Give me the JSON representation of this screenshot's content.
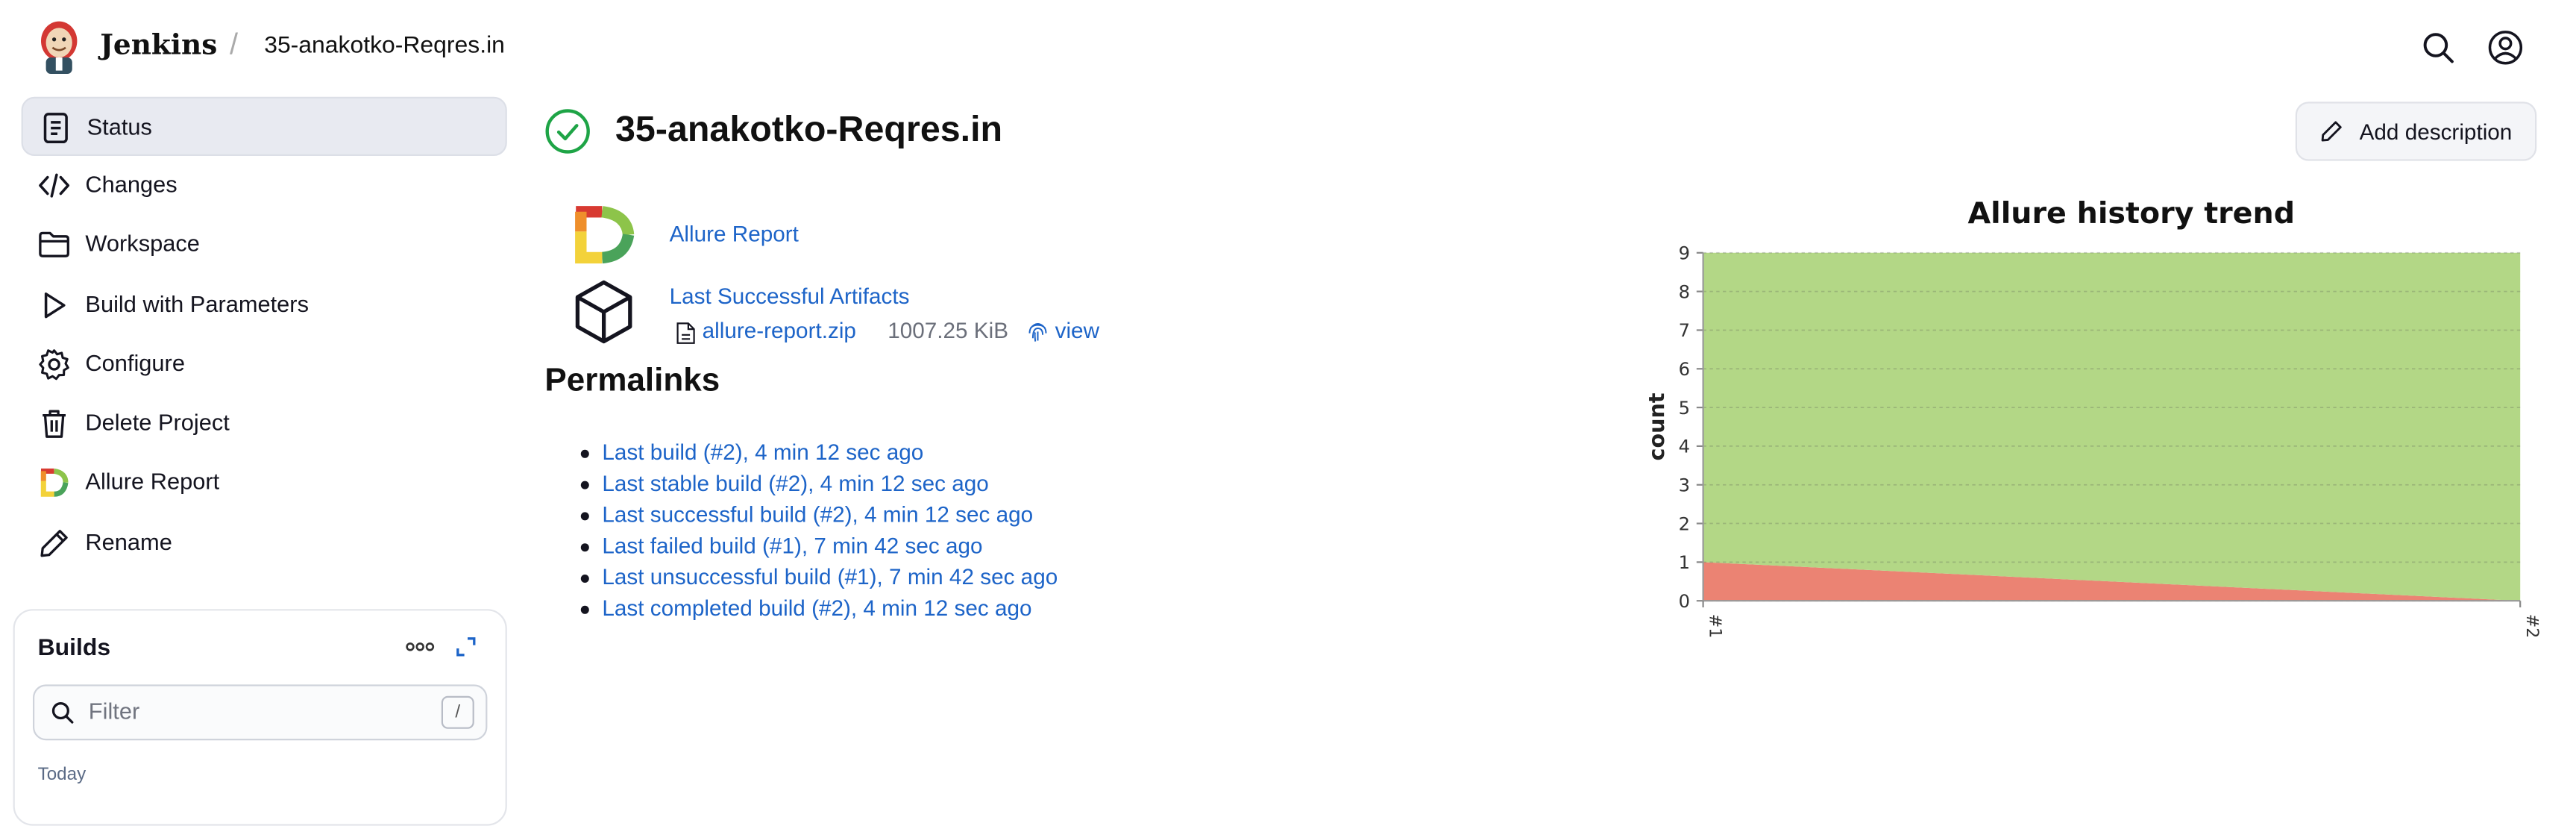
{
  "header": {
    "brand": "Jenkins",
    "breadcrumb": "35-anakotko-Reqres.in"
  },
  "sidebar": {
    "items": [
      {
        "label": "Status",
        "icon": "status-document-icon",
        "active": true
      },
      {
        "label": "Changes",
        "icon": "code-icon"
      },
      {
        "label": "Workspace",
        "icon": "folder-icon"
      },
      {
        "label": "Build with Parameters",
        "icon": "play-icon"
      },
      {
        "label": "Configure",
        "icon": "gear-icon"
      },
      {
        "label": "Delete Project",
        "icon": "trash-icon"
      },
      {
        "label": "Allure Report",
        "icon": "allure-logo-icon"
      },
      {
        "label": "Rename",
        "icon": "pencil-icon"
      }
    ]
  },
  "builds": {
    "title": "Builds",
    "filter_placeholder": "Filter",
    "shortcut": "/",
    "group_label": "Today"
  },
  "main": {
    "title": "35-anakotko-Reqres.in",
    "status": "success",
    "add_description": "Add description",
    "allure_report_link": "Allure Report",
    "last_successful_artifacts": "Last Successful Artifacts",
    "artifact": {
      "name": "allure-report.zip",
      "size": "1007.25 KiB",
      "view": "view"
    },
    "permalinks_heading": "Permalinks",
    "permalinks": [
      "Last build (#2), 4 min 12 sec ago",
      "Last stable build (#2), 4 min 12 sec ago",
      "Last successful build (#2), 4 min 12 sec ago",
      "Last failed build (#1), 7 min 42 sec ago",
      "Last unsuccessful build (#1), 7 min 42 sec ago",
      "Last completed build (#2), 4 min 12 sec ago"
    ]
  },
  "colors": {
    "link": "#1d64c8",
    "success": "#1ea446",
    "passed_area": "#b3d786",
    "failed_area": "#eb8373"
  },
  "chart_data": {
    "type": "area",
    "title": "Allure history trend",
    "xlabel": "",
    "ylabel": "count",
    "x": [
      "#1",
      "#2"
    ],
    "ylim": [
      0,
      9
    ],
    "yticks": [
      0,
      1,
      2,
      3,
      4,
      5,
      6,
      7,
      8,
      9
    ],
    "grid": true,
    "stacked": true,
    "series": [
      {
        "values": [
          1,
          0
        ],
        "color": "#eb8373"
      },
      {
        "values": [
          8,
          9
        ],
        "color": "#b3d786"
      }
    ]
  }
}
